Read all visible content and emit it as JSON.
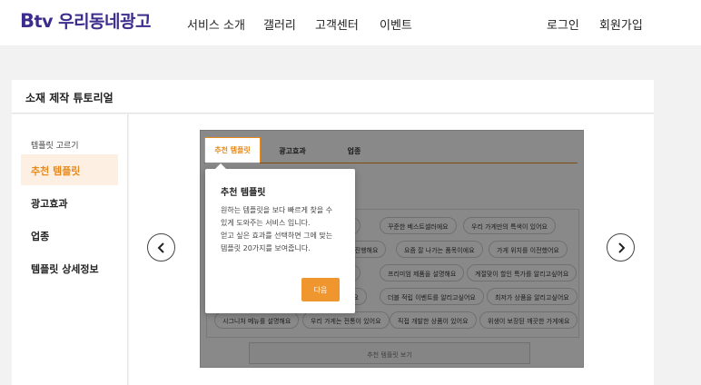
{
  "header": {
    "logo_b": "B",
    "logo_rest": "tv 우리동네광고",
    "nav": [
      "서비스 소개",
      "갤러리",
      "고객센터",
      "이벤트"
    ],
    "login": "로그인",
    "signup": "회원가입"
  },
  "page": {
    "title": "소재 제작 튜토리얼"
  },
  "sidebar": {
    "caption": "템플릿 고르기",
    "items": [
      "추천 템플릿",
      "광고효과",
      "업종",
      "템플릿 상세정보"
    ]
  },
  "preview": {
    "tabs": [
      "추천 템플릿",
      "광고효과",
      "업종"
    ],
    "chips": [
      [
        "요",
        "꾸준한 베스트셀러에요",
        "우리 가게만의 특색이 있어요"
      ],
      [
        "을 진행해요",
        "요즘 잘 나가는 품목이에요",
        "가게 위치를 이전했어요"
      ],
      [
        "요",
        "프리미엄 제품을 설명해요",
        "계절맞이 할인 특가를 알리고싶어요"
      ],
      [
        "어요",
        "더블 적립 이벤트를 알리고싶어요",
        "최저가 상품을 알리고싶어요"
      ],
      [
        "시그니처 메뉴를 설명해요",
        "우리 가게는 전통이 있어요",
        "직접 개발한 상품이 있어요",
        "위생이 보장된 깨끗한 가게에요"
      ]
    ],
    "bottom_button": "추천 템플릿 보기"
  },
  "popover": {
    "title": "추천 템플릿",
    "body": "원하는 템플릿을 보다 빠르게 찾을 수\n있게 도와주는 서비스 입니다.\n얻고 싶은 효과를 선택하면 그에 맞는\n템플릿 20가지를 보여줍니다.",
    "next": "다음"
  },
  "colors": {
    "brand": "#3d2c8e",
    "accent": "#e8891d",
    "button": "#f0962e"
  },
  "icons": {
    "prev": "chevron-left-icon",
    "next": "chevron-right-icon"
  }
}
